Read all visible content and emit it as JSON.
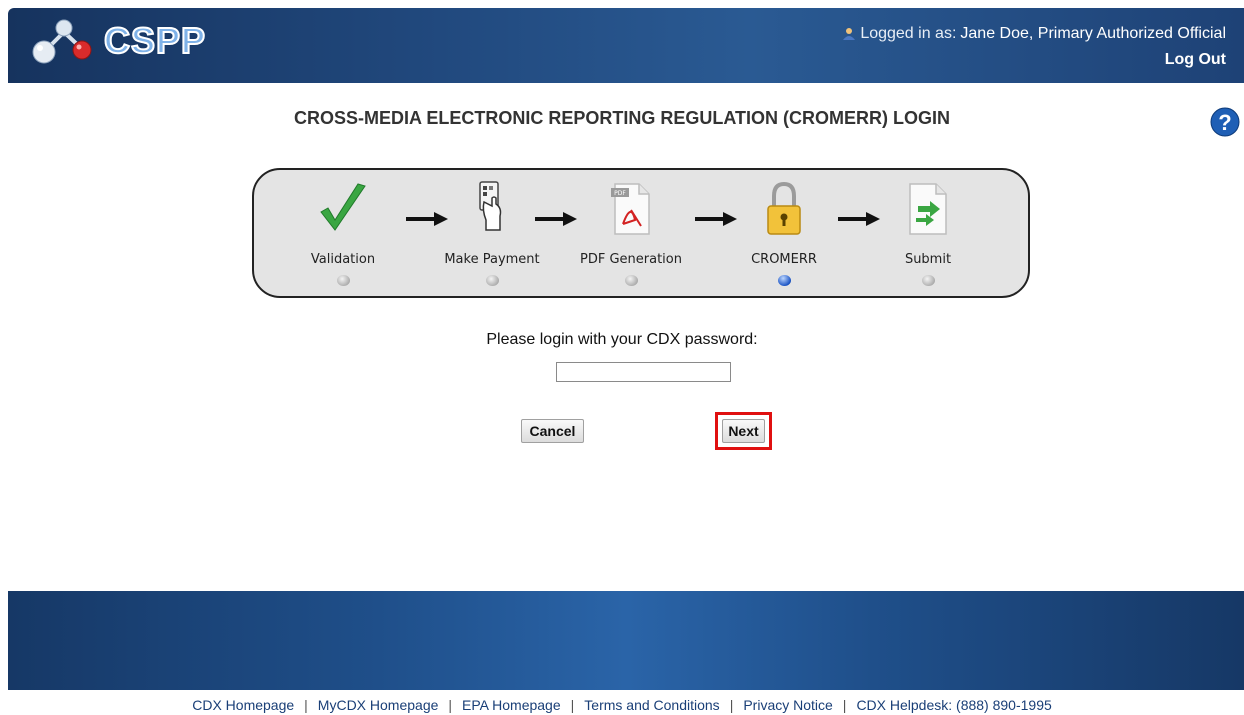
{
  "header": {
    "logo_text": "CSPP",
    "logged_in_prefix": "Logged in as:",
    "user_name": "Jane Doe, Primary Authorized Official",
    "logout_label": "Log Out"
  },
  "page": {
    "title": "CROSS-MEDIA ELECTRONIC REPORTING REGULATION (CROMERR) LOGIN",
    "help_icon": "question-mark-icon"
  },
  "steps": [
    {
      "label": "Validation",
      "icon": "checkmark-icon",
      "active": false
    },
    {
      "label": "Make Payment",
      "icon": "payment-card-icon",
      "active": false
    },
    {
      "label": "PDF Generation",
      "icon": "pdf-icon",
      "active": false
    },
    {
      "label": "CROMERR",
      "icon": "lock-icon",
      "active": true
    },
    {
      "label": "Submit",
      "icon": "submit-document-icon",
      "active": false
    }
  ],
  "login": {
    "prompt": "Please login with your CDX password:",
    "password_value": "",
    "cancel_label": "Cancel",
    "next_label": "Next"
  },
  "footer": {
    "links": [
      "CDX Homepage",
      "MyCDX Homepage",
      "EPA Homepage",
      "Terms and Conditions",
      "Privacy Notice",
      "CDX Helpdesk: (888) 890-1995"
    ]
  },
  "colors": {
    "header_bg": "#21497e",
    "highlight_border": "#e01010",
    "active_dot": "#1b54c4",
    "link": "#1a3f77"
  }
}
